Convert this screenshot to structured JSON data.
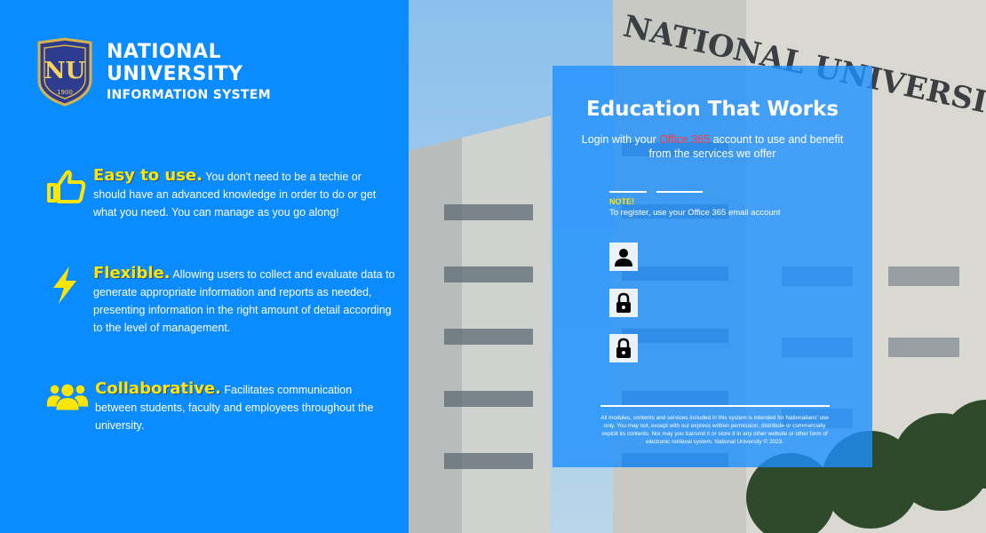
{
  "brand": {
    "line1": "NATIONAL",
    "line2": "UNIVERSITY",
    "line3": "INFORMATION SYSTEM",
    "crest_letters": "NU",
    "crest_year": "1900",
    "colors": {
      "panel": "#0a8bff",
      "accent": "#ffe600",
      "crest": "#2e3c8f"
    }
  },
  "features": [
    {
      "icon": "thumbs-up-icon",
      "title": "Easy to use.",
      "text": "You don't need to be a techie or should have an advanced knowledge in order to do or get what you need. You can manage as you go along!"
    },
    {
      "icon": "lightning-icon",
      "title": "Flexible.",
      "text": "Allowing users to collect and evaluate data to generate appropriate information and reports as needed, presenting information in the right amount of detail according to the level of management."
    },
    {
      "icon": "group-icon",
      "title": "Collaborative.",
      "text": "Facilitates communication between students, faculty and employees throughout the university."
    }
  ],
  "background": {
    "sign_text": "NATIONAL UNIVERSIT"
  },
  "login": {
    "title": "Education That Works",
    "subtitle_before": "Login with your ",
    "subtitle_highlight": "Office 365",
    "subtitle_after": " account to use  and benefit from the services we offer",
    "note_label": "NOTE!",
    "note_text": "To register, use your Office 365 email account",
    "username_icon": "user-icon",
    "password_icon": "lock-icon",
    "confirm_icon": "lock-icon",
    "footer": "All modules, contents and services included in this system is intended for Nationalians' use only. You may not, except with our express written permission, distribute or commercially exploit its contents. Nor may you transmit it or store it in any other website or other form of electronic retrieval system. National University © 2023."
  }
}
